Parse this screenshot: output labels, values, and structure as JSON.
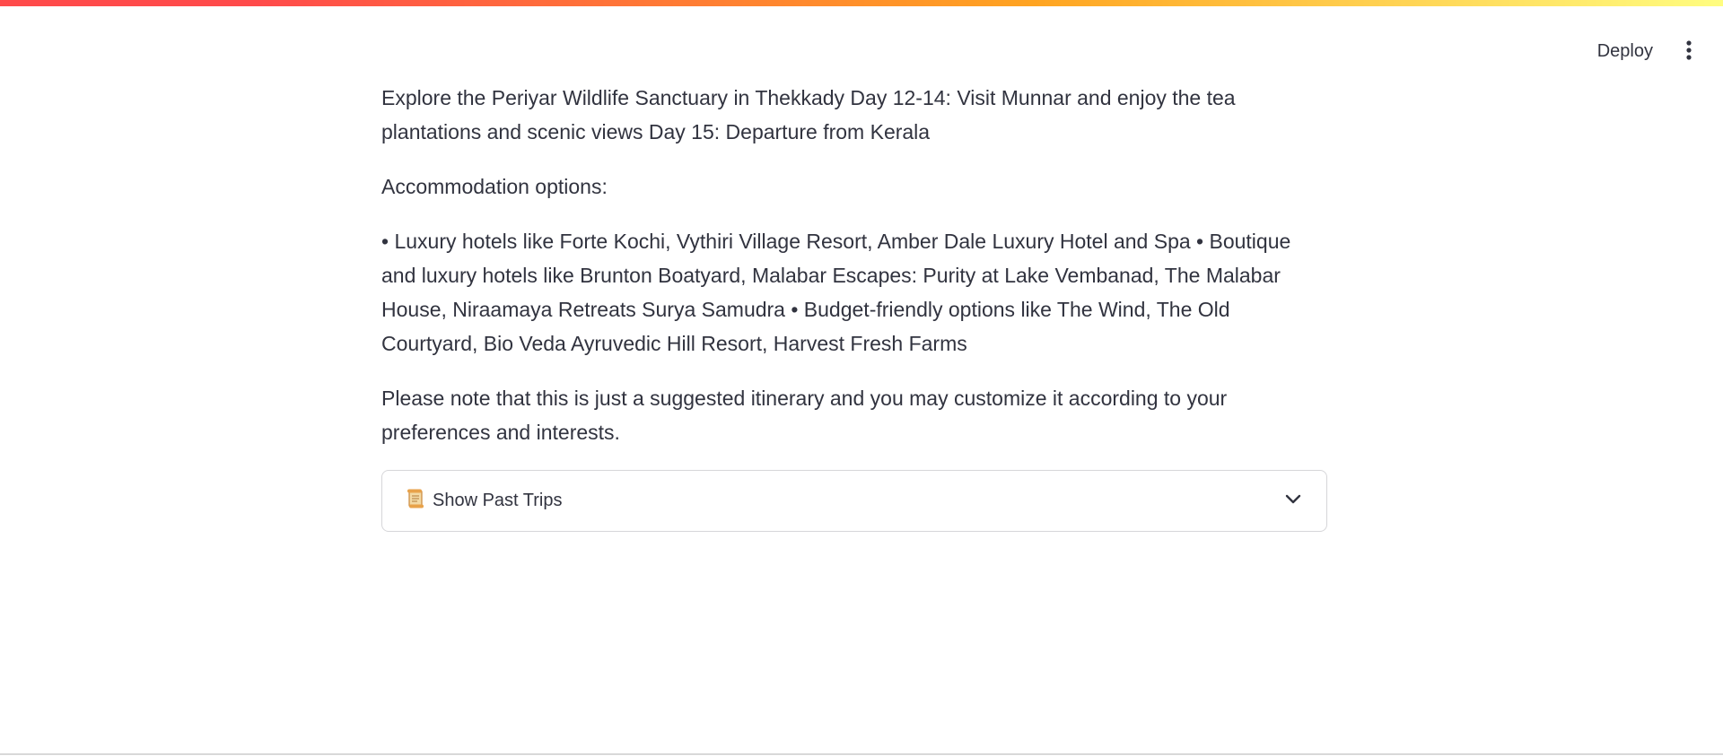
{
  "header": {
    "deploy_label": "Deploy",
    "menu_icon": "more-vertical-icon"
  },
  "content": {
    "paragraph_1": "Explore the Periyar Wildlife Sanctuary in Thekkady Day 12-14: Visit Munnar and enjoy the tea plantations and scenic views Day 15: Departure from Kerala",
    "paragraph_2": "Accommodation options:",
    "paragraph_3": "• Luxury hotels like Forte Kochi, Vythiri Village Resort, Amber Dale Luxury Hotel and Spa • Boutique and luxury hotels like Brunton Boatyard, Malabar Escapes: Purity at Lake Vembanad, The Malabar House, Niraamaya Retreats Surya Samudra • Budget-friendly options like The Wind, The Old Courtyard, Bio Veda Ayruvedic Hill Resort, Harvest Fresh Farms",
    "paragraph_4": "Please note that this is just a suggested itinerary and you may customize it according to your preferences and interests."
  },
  "expander": {
    "icon": "scroll-icon",
    "label": "Show Past Trips",
    "toggle_icon": "chevron-down-icon"
  },
  "colors": {
    "text": "#31333f",
    "border": "#d6d6d9",
    "accent_red": "#ff4b4b",
    "accent_orange": "#ffa421",
    "accent_yellow": "#fffd80"
  }
}
